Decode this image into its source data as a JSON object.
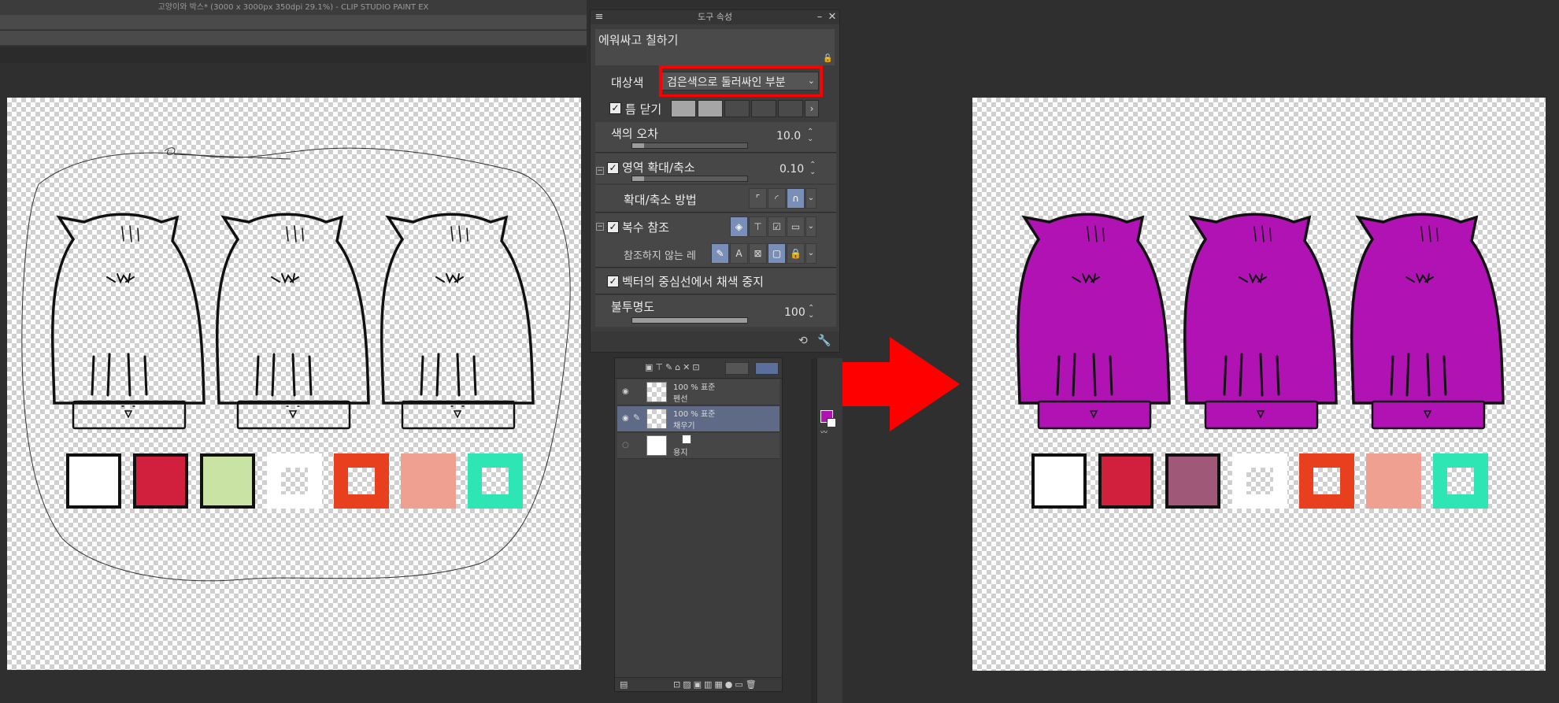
{
  "window": {
    "title": "고양이와 박스* (3000 x 3000px 350dpi 29.1%)  - CLIP STUDIO PAINT EX"
  },
  "tool_property": {
    "header": "도구 속성",
    "tool_name": "에워싸고 칠하기",
    "target_color": {
      "label": "대상색",
      "value": "검은색으로 둘러싸인 부분"
    },
    "close_gap": {
      "label": "틈 닫기",
      "checked": true
    },
    "color_tolerance": {
      "label": "색의 오차",
      "value": "10.0"
    },
    "area_scaling": {
      "label": "영역 확대/축소",
      "value": "0.10",
      "checked": true
    },
    "scaling_method": {
      "label": "확대/축소 방법"
    },
    "multi_ref": {
      "label": "복수 참조",
      "checked": true
    },
    "exclude_ref": {
      "label": "참조하지 않는 레"
    },
    "stop_vector": {
      "label": "벡터의 중심선에서 채색 중지",
      "checked": true
    },
    "opacity": {
      "label": "불투명도",
      "value": "100"
    }
  },
  "layers": [
    {
      "mode": "100 % 표준",
      "name": "펜선"
    },
    {
      "mode": "100 % 표준",
      "name": "채우기"
    },
    {
      "mode": "",
      "name": "용지"
    }
  ],
  "colors": {
    "fill_purple": "#b012b4",
    "highlight_red": "#ff0000",
    "selected_layer": "#5f6a86"
  },
  "icons": {
    "menu": "hamburger-icon",
    "minimize": "minimize-icon",
    "close": "close-icon",
    "lock": "lock-icon",
    "dropdown": "chevron-down-icon",
    "next": "chevron-right-icon",
    "spinner": "spinner-icon",
    "reset": "reset-icon",
    "wrench": "wrench-icon",
    "eye": "eye-icon",
    "pen": "pen-icon",
    "arrow": "right-arrow-icon"
  }
}
